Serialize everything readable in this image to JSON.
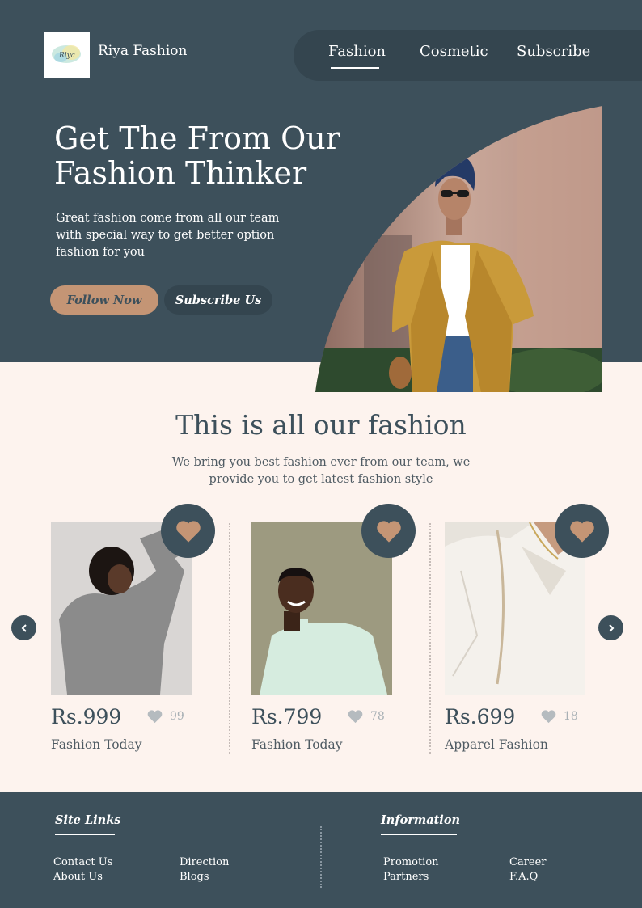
{
  "brand": {
    "name": "Riya Fashion",
    "logo_text": "Riya"
  },
  "nav": {
    "items": [
      "Fashion",
      "Cosmetic",
      "Subscribe"
    ],
    "active": "Fashion"
  },
  "hero": {
    "title_line1": "Get The From Our",
    "title_line2": "Fashion Thinker",
    "subtitle": "Great fashion come from all our team with special way to get better option fashion for you",
    "follow_label": "Follow Now",
    "subscribe_label": "Subscribe Us"
  },
  "section": {
    "title": "This is all our fashion",
    "subtitle": "We bring you best fashion ever from our team, we provide you to get latest fashion style"
  },
  "products": [
    {
      "price": "Rs.999",
      "likes": "99",
      "name": "Fashion Today"
    },
    {
      "price": "Rs.799",
      "likes": "78",
      "name": "Fashion Today"
    },
    {
      "price": "Rs.699",
      "likes": "18",
      "name": "Apparel Fashion"
    }
  ],
  "footer": {
    "site_links": {
      "title": "Site Links",
      "links": [
        "Contact Us",
        "About Us",
        "Direction",
        "Blogs"
      ]
    },
    "information": {
      "title": "Information",
      "links": [
        "Promotion",
        "Partners",
        "Career",
        "F.A.Q"
      ]
    }
  },
  "colors": {
    "primary": "#3d505b",
    "accent": "#c49575",
    "background": "#fdf3ee",
    "heart": "#c49575"
  },
  "icons": {
    "heart": "heart-icon",
    "prev": "chevron-left-icon",
    "next": "chevron-right-icon"
  }
}
